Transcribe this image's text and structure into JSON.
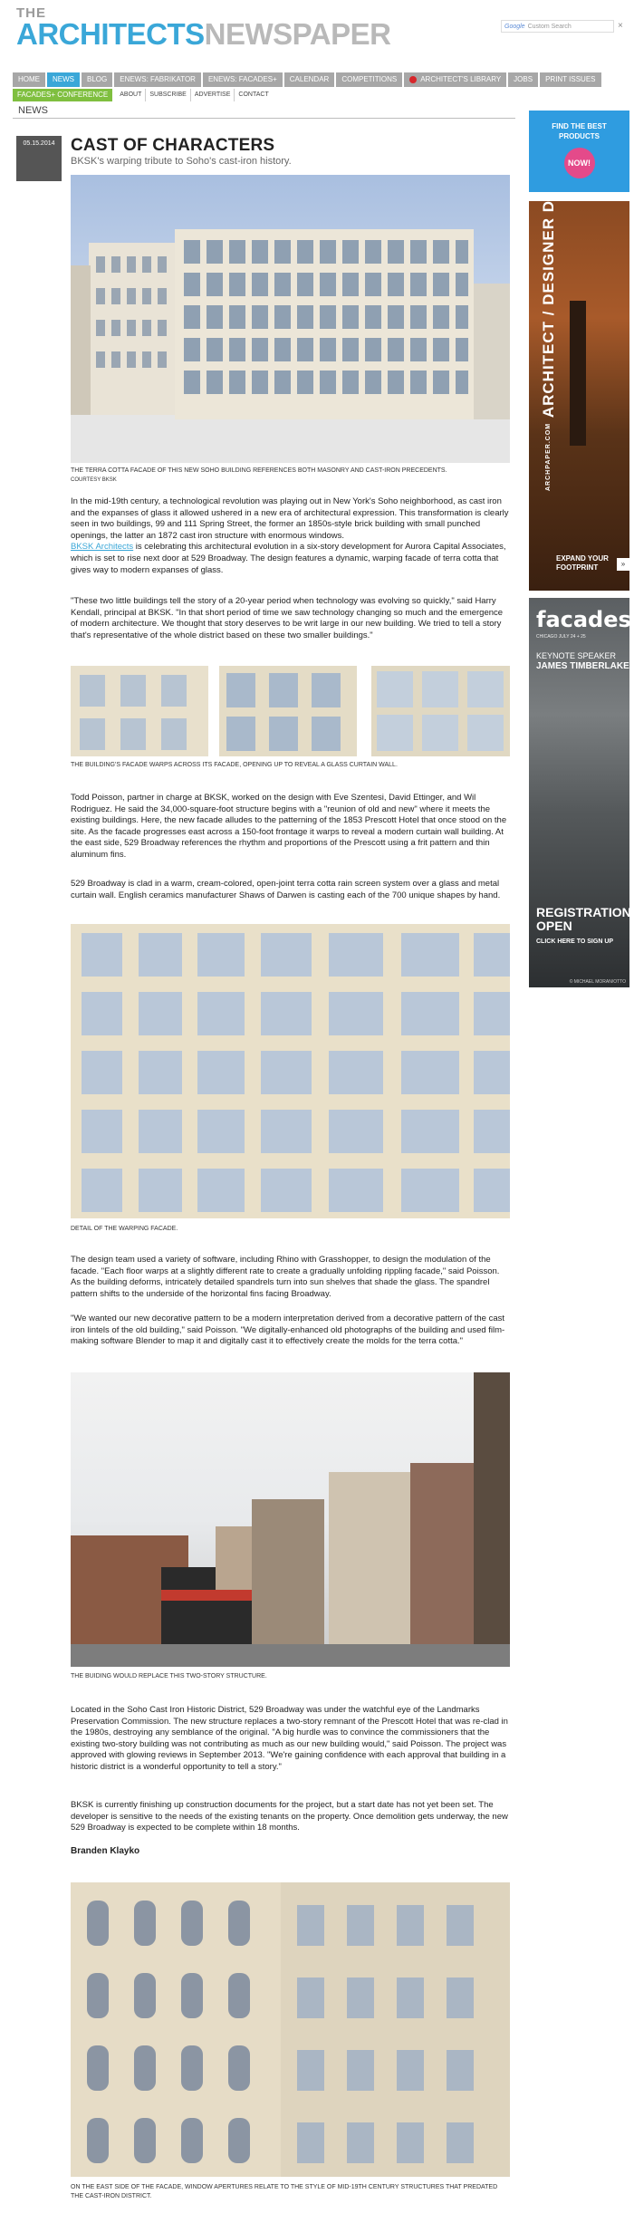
{
  "header": {
    "brand_the": "THE",
    "brand_part1": "ARCHITECTS",
    "brand_part2": "NEWSPAPER",
    "search_engine_label": "Google",
    "search_placeholder": "Custom Search",
    "search_close": "×"
  },
  "nav": {
    "primary": [
      "HOME",
      "NEWS",
      "BLOG",
      "ENEWS: FABRIKATOR",
      "ENEWS: FACADES+",
      "CALENDAR",
      "COMPETITIONS",
      "ARCHITECT'S LIBRARY",
      "JOBS",
      "PRINT ISSUES"
    ],
    "active": "NEWS",
    "conference": "FACADES+ CONFERENCE",
    "secondary": [
      "ABOUT",
      "SUBSCRIBE",
      "ADVERTISE",
      "CONTACT"
    ]
  },
  "section_label": "NEWS",
  "article": {
    "date": "05.15.2014",
    "title": "CAST OF CHARACTERS",
    "subtitle": "BKSK's warping tribute to Soho's cast-iron history.",
    "captions": {
      "c1": "THE TERRA COTTA FACADE OF THIS NEW SOHO BUILDING REFERENCES BOTH MASONRY AND CAST-IRON PRECEDENTS.",
      "c1_courtesy": "COURTESY BKSK",
      "c2": "THE BUILDING'S FACADE WARPS ACROSS ITS FACADE, OPENING UP TO REVEAL A GLASS CURTAIN WALL.",
      "c3": "DETAIL OF THE WARPING FACADE.",
      "c4": "THE BUIDING WOULD REPLACE THIS TWO-STORY STRUCTURE.",
      "c5": "ON THE EAST SIDE OF THE FACADE, WINDOW APERTURES RELATE TO THE STYLE OF MID-19TH CENTURY STRUCTURES THAT PREDATED THE CAST-IRON DISTRICT."
    },
    "p1": "In the mid-19th century, a technological revolution was playing out in New York's Soho neighborhood, as cast iron and the expanses of glass it allowed ushered in a new era of architectural expression. This transformation is clearly seen in two buildings, 99 and 111 Spring Street, the former an 1850s-style brick building with small punched openings, the latter an 1872 cast iron structure with enormous windows.",
    "p1_link": "BKSK Architects",
    "p1_rest": " is celebrating this architectural evolution in a six-story development for Aurora Capital Associates, which is set to rise next door at 529 Broadway. The design features a dynamic, warping facade of terra cotta that gives way to modern expanses of glass.",
    "p2": "\"These two little buildings tell the story of a 20-year period when technology was evolving so quickly,\" said Harry Kendall, principal at BKSK. \"In that short period of time we saw technology changing so much and the emergence of modern architecture. We thought that story deserves to be writ large in our new building. We tried to tell a story that's representative of the whole district based on these two smaller buildings.\"",
    "p3": "Todd Poisson, partner in charge at BKSK, worked on the design with Eve Szentesi, David Ettinger, and Wil Rodriguez. He said the 34,000-square-foot structure begins with a \"reunion of old and new\" where it meets the existing buildings. Here, the new facade alludes to the patterning of the 1853 Prescott Hotel that once stood on the site. As the facade progresses east across a 150-foot frontage it warps to reveal a modern curtain wall building. At the east side, 529 Broadway references the rhythm and proportions of the Prescott using a frit pattern and thin aluminum fins.",
    "p4": "529 Broadway is clad in a warm, cream-colored, open-joint terra cotta rain screen system over a glass and metal curtain wall. English ceramics manufacturer Shaws of Darwen is casting each of the 700 unique shapes by hand.",
    "p5": "The design team used a variety of software, including Rhino with Grasshopper, to design the modulation of the facade. \"Each floor warps at a slightly different rate to create a gradually unfolding rippling facade,\" said Poisson. As the building deforms, intricately detailed spandrels turn into sun shelves that shade the glass. The spandrel pattern shifts to the underside of the horizontal fins facing Broadway.",
    "p6": "\"We wanted our new decorative pattern to be a modern interpretation derived from a decorative pattern of the cast iron lintels of the old building,\" said Poisson. \"We digitally-enhanced old photographs of the building and used film-making software Blender to map it and digitally cast it to effectively create the molds for the terra cotta.\"",
    "p7": "Located in the Soho Cast Iron Historic District, 529 Broadway was under the watchful eye of the Landmarks Preservation Commission. The new structure replaces a two-story remnant of the Prescott Hotel that was re-clad in the 1980s, destroying any semblance of the original. \"A big hurdle was to convince the commissioners that the existing two-story building was not contributing as much as our new building would,\" said Poisson. The project was approved with glowing reviews in September 2013. \"We're gaining confidence with each approval that building in a historic district is a wonderful opportunity to tell a story.\"",
    "p8": "BKSK is currently finishing up construction documents for the project, but a start date has not yet been set. The developer is sensitive to the needs of the existing tenants on the property. Once demolition gets underway, the new 529 Broadway is expected to be complete within 18 months.",
    "author": "Branden Klayko"
  },
  "ads": {
    "products_line1": "FIND THE BEST",
    "products_line2": "PRODUCTS",
    "products_now": "NOW!",
    "arch_small": "ARCHPAPER.COM",
    "arch_big": "ARCHITECT / DESIGNER DIRECTORY",
    "arch_expand": "EXPAND YOUR FOOTPRINT",
    "arch_arrow": "»",
    "facades_logo": "facades+",
    "facades_sub": "CHICAGO JULY 24 + 25",
    "facades_keynote": "KEYNOTE SPEAKER",
    "facades_speaker": "JAMES TIMBERLAKE",
    "facades_reg1": "REGISTRATION",
    "facades_reg2": "OPEN",
    "facades_signup": "CLICK HERE TO SIGN UP",
    "facades_credit": "© MICHAEL MORAN/OTTO"
  }
}
